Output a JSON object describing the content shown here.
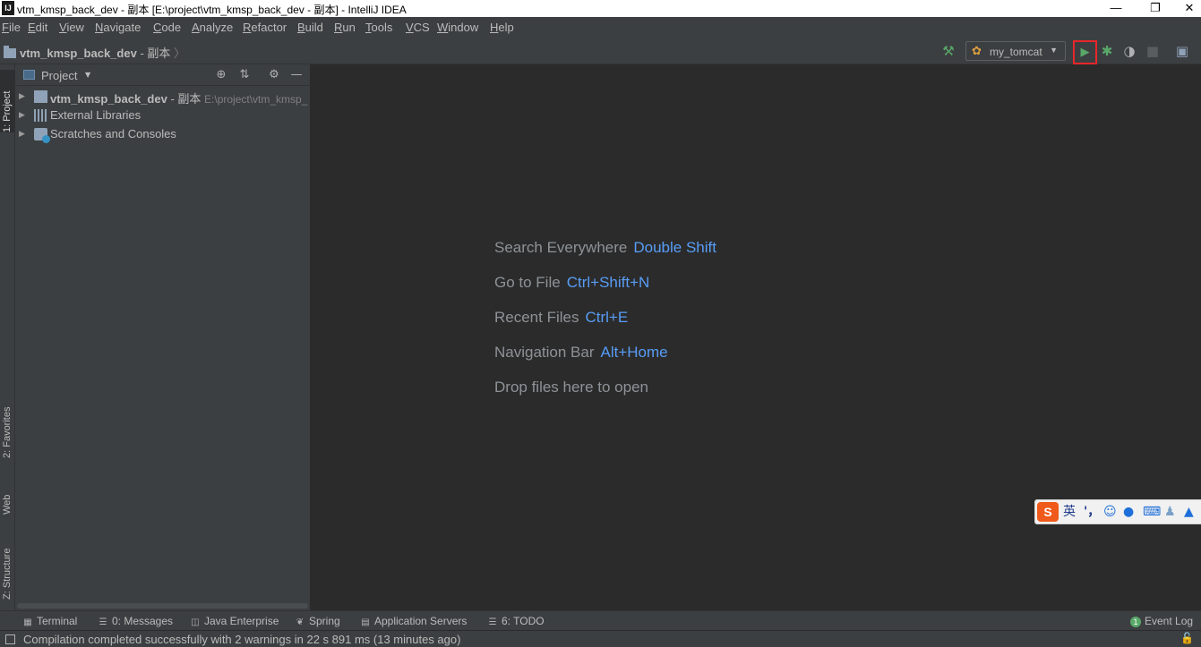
{
  "window": {
    "title": "vtm_kmsp_back_dev - 副本 [E:\\project\\vtm_kmsp_back_dev - 副本] - IntelliJ IDEA",
    "app_icon": "IJ",
    "controls": [
      "minimize-icon",
      "restore-icon",
      "close-icon"
    ]
  },
  "menu": {
    "items": [
      "File",
      "Edit",
      "View",
      "Navigate",
      "Code",
      "Analyze",
      "Refactor",
      "Build",
      "Run",
      "Tools",
      "VCS",
      "Window",
      "Help"
    ]
  },
  "navbar": {
    "project_name": "vtm_kmsp_back_dev",
    "project_suffix": "- 副本",
    "run_config": "my_tomcat"
  },
  "left_tabs": {
    "project": "1: Project",
    "favorites": "2: Favorites",
    "web": "Web",
    "structure": "Z: Structure"
  },
  "project_panel": {
    "title": "Project",
    "tree": [
      {
        "name": "vtm_kmsp_back_dev",
        "suffix": "- 副本",
        "path": "E:\\project\\vtm_kmsp_",
        "icon": "module-folder-icon"
      },
      {
        "name": "External Libraries",
        "icon": "library-icon"
      },
      {
        "name": "Scratches and Consoles",
        "icon": "scratches-icon"
      }
    ]
  },
  "editor": {
    "hints": [
      {
        "label": "Search Everywhere",
        "key": "Double Shift"
      },
      {
        "label": "Go to File",
        "key": "Ctrl+Shift+N"
      },
      {
        "label": "Recent Files",
        "key": "Ctrl+E"
      },
      {
        "label": "Navigation Bar",
        "key": "Alt+Home"
      },
      {
        "label": "Drop files here to open",
        "key": ""
      }
    ]
  },
  "ime_toolbar": {
    "logo": "S",
    "mode": "英",
    "punct": "'，"
  },
  "bottom_tabs": {
    "terminal": "Terminal",
    "messages": "0: Messages",
    "java_enterprise": "Java Enterprise",
    "spring": "Spring",
    "app_servers": "Application Servers",
    "todo": "6: TODO",
    "event_log": "Event Log",
    "event_log_count": "1"
  },
  "status": {
    "message": "Compilation completed successfully with 2 warnings in 22 s 891 ms (13 minutes ago)"
  },
  "colors": {
    "accent_key": "#589df6",
    "run_green": "#59a869",
    "highlight_red": "#e8262a"
  }
}
